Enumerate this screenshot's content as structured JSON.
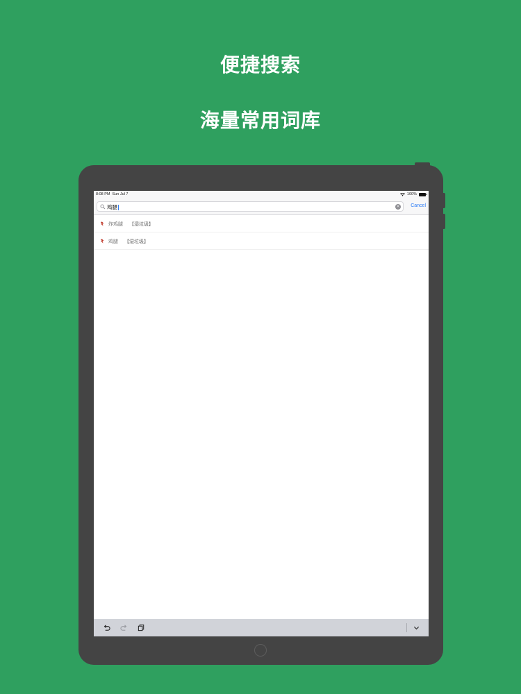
{
  "promo": {
    "headline1": "便捷搜索",
    "headline2": "海量常用词库"
  },
  "status_bar": {
    "time": "8:08 PM",
    "date": "Sun Jul 7",
    "battery": "100%"
  },
  "search": {
    "query": "鸡腿",
    "cancel_label": "Cancel"
  },
  "results": [
    {
      "name": "炸鸡腿",
      "category": "【湿垃圾】",
      "icon": "waste-category-icon"
    },
    {
      "name": "鸡腿",
      "category": "【湿垃圾】",
      "icon": "waste-category-icon"
    }
  ],
  "colors": {
    "background": "#2fa05f",
    "device_frame": "#444444",
    "accent": "#2c7cf6",
    "result_icon": "#c0392b"
  }
}
